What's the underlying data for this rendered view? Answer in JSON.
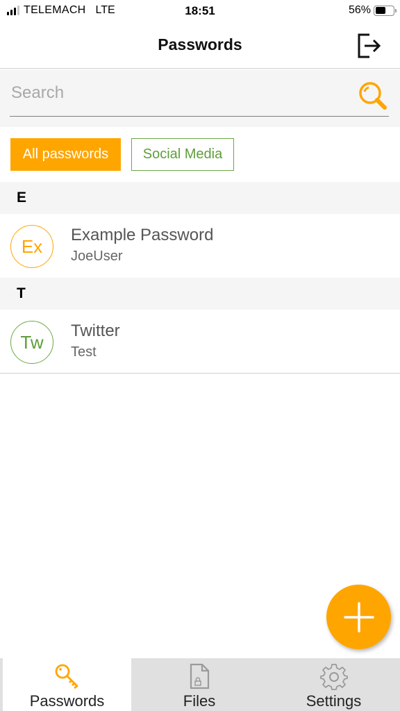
{
  "status_bar": {
    "carrier": "TELEMACH",
    "network": "LTE",
    "time": "18:51",
    "battery": "56%",
    "battery_level": 0.56,
    "signal_bars_active": 3,
    "signal_bars_total": 4
  },
  "header": {
    "title": "Passwords",
    "logout_icon": "logout-icon"
  },
  "search": {
    "placeholder": "Search",
    "value": "",
    "icon": "search-icon"
  },
  "filters": [
    {
      "label": "All passwords",
      "active": true
    },
    {
      "label": "Social Media",
      "active": false
    }
  ],
  "sections": [
    {
      "letter": "E",
      "items": [
        {
          "initials": "Ex",
          "title": "Example Password",
          "subtitle": "JoeUser",
          "color": "#ffa500"
        }
      ]
    },
    {
      "letter": "T",
      "items": [
        {
          "initials": "Tw",
          "title": "Twitter",
          "subtitle": "Test",
          "color": "#6aa843"
        }
      ]
    }
  ],
  "fab": {
    "icon": "plus-icon"
  },
  "tabs": [
    {
      "label": "Passwords",
      "icon": "key-icon",
      "active": true
    },
    {
      "label": "Files",
      "icon": "locked-file-icon",
      "active": false
    },
    {
      "label": "Settings",
      "icon": "gear-icon",
      "active": false
    }
  ],
  "colors": {
    "accent": "#ffa500",
    "green": "#6aa843",
    "inactive_icon": "#9a9a9a"
  }
}
